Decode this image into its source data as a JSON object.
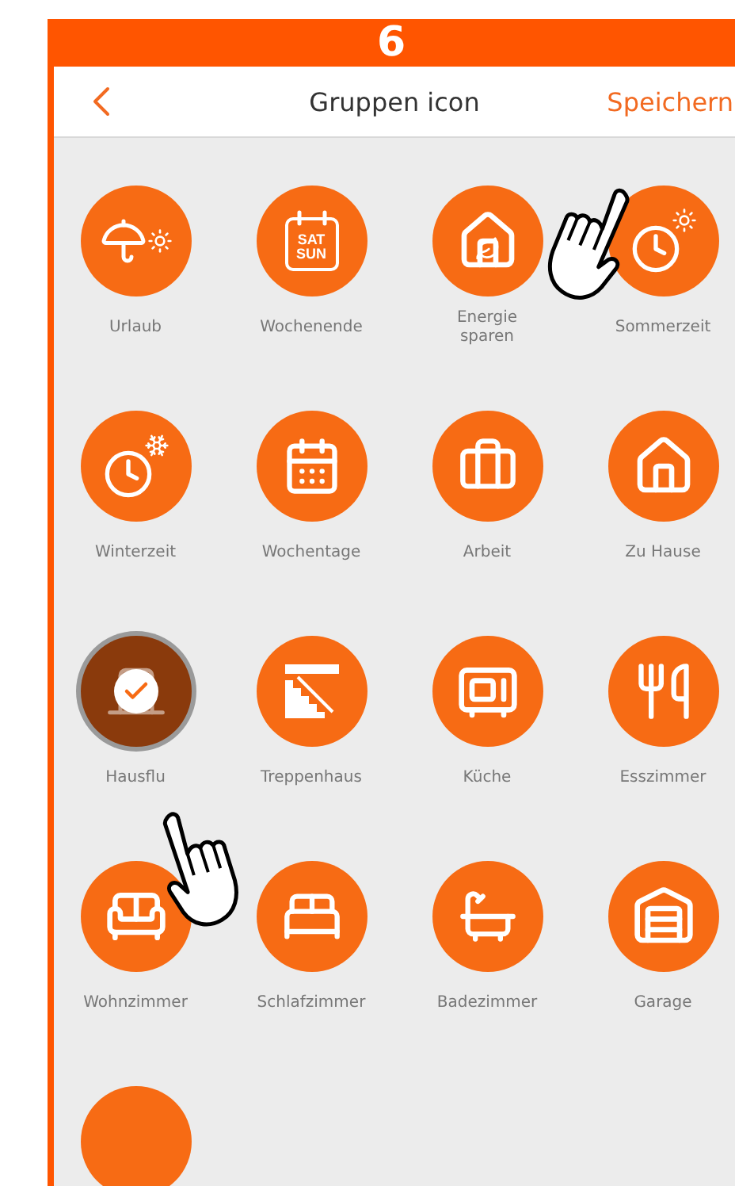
{
  "step_banner": {
    "number": "6"
  },
  "nav_bar": {
    "title": "Gruppen icon",
    "save_label": "Speichern"
  },
  "icons": [
    {
      "label": "Urlaub",
      "selected": false
    },
    {
      "label": "Wochenende",
      "selected": false,
      "icon_text": [
        "SAT",
        "SUN"
      ]
    },
    {
      "label": "Energie sparen",
      "selected": false
    },
    {
      "label": "Sommerzeit",
      "selected": false
    },
    {
      "label": "Winterzeit",
      "selected": false
    },
    {
      "label": "Wochentage",
      "selected": false
    },
    {
      "label": "Arbeit",
      "selected": false
    },
    {
      "label": "Zu Hause",
      "selected": false
    },
    {
      "label": "Hausflu",
      "selected": true
    },
    {
      "label": "Treppenhaus",
      "selected": false
    },
    {
      "label": "Küche",
      "selected": false
    },
    {
      "label": "Esszimmer",
      "selected": false
    },
    {
      "label": "Wohnzimmer",
      "selected": false
    },
    {
      "label": "Schlafzimmer",
      "selected": false
    },
    {
      "label": "Badezimmer",
      "selected": false
    },
    {
      "label": "Garage",
      "selected": false
    },
    {
      "selected": false
    }
  ]
}
